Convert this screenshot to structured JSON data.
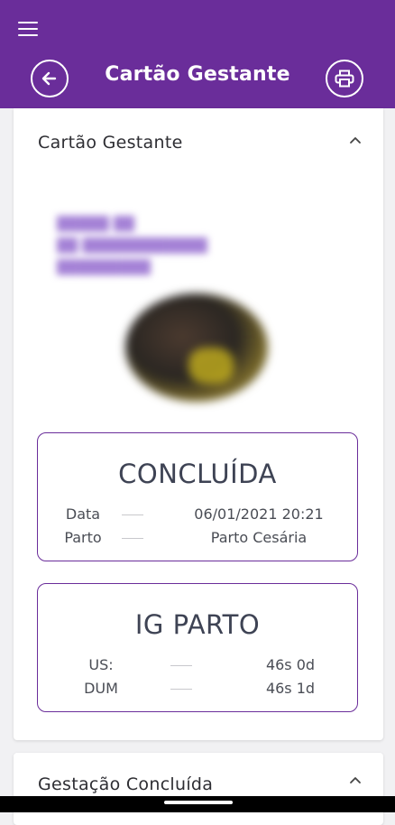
{
  "appbar": {
    "title": "Cartão Gestante",
    "color": "#6a2d9a",
    "menu_icon": "hamburger-icon",
    "back_icon": "arrow-left-icon",
    "print_icon": "printer-icon"
  },
  "card_main": {
    "title": "Cartão Gestante",
    "chevron_icon": "chevron-up-icon",
    "blurred_text_lines": [
      "█████ ██",
      "██ ████████████",
      "█████████"
    ],
    "status_box": {
      "heading": "CONCLUÍDA",
      "rows": [
        {
          "label": "Data",
          "value": "06/01/2021 20:21"
        },
        {
          "label": "Parto",
          "value": "Parto Cesária"
        }
      ]
    },
    "ig_box": {
      "heading": "IG PARTO",
      "rows": [
        {
          "label": "US:",
          "value": "46s 0d"
        },
        {
          "label": "DUM",
          "value": "46s 1d"
        }
      ]
    }
  },
  "card_second": {
    "title": "Gestação Concluída",
    "chevron_icon": "chevron-up-icon"
  }
}
